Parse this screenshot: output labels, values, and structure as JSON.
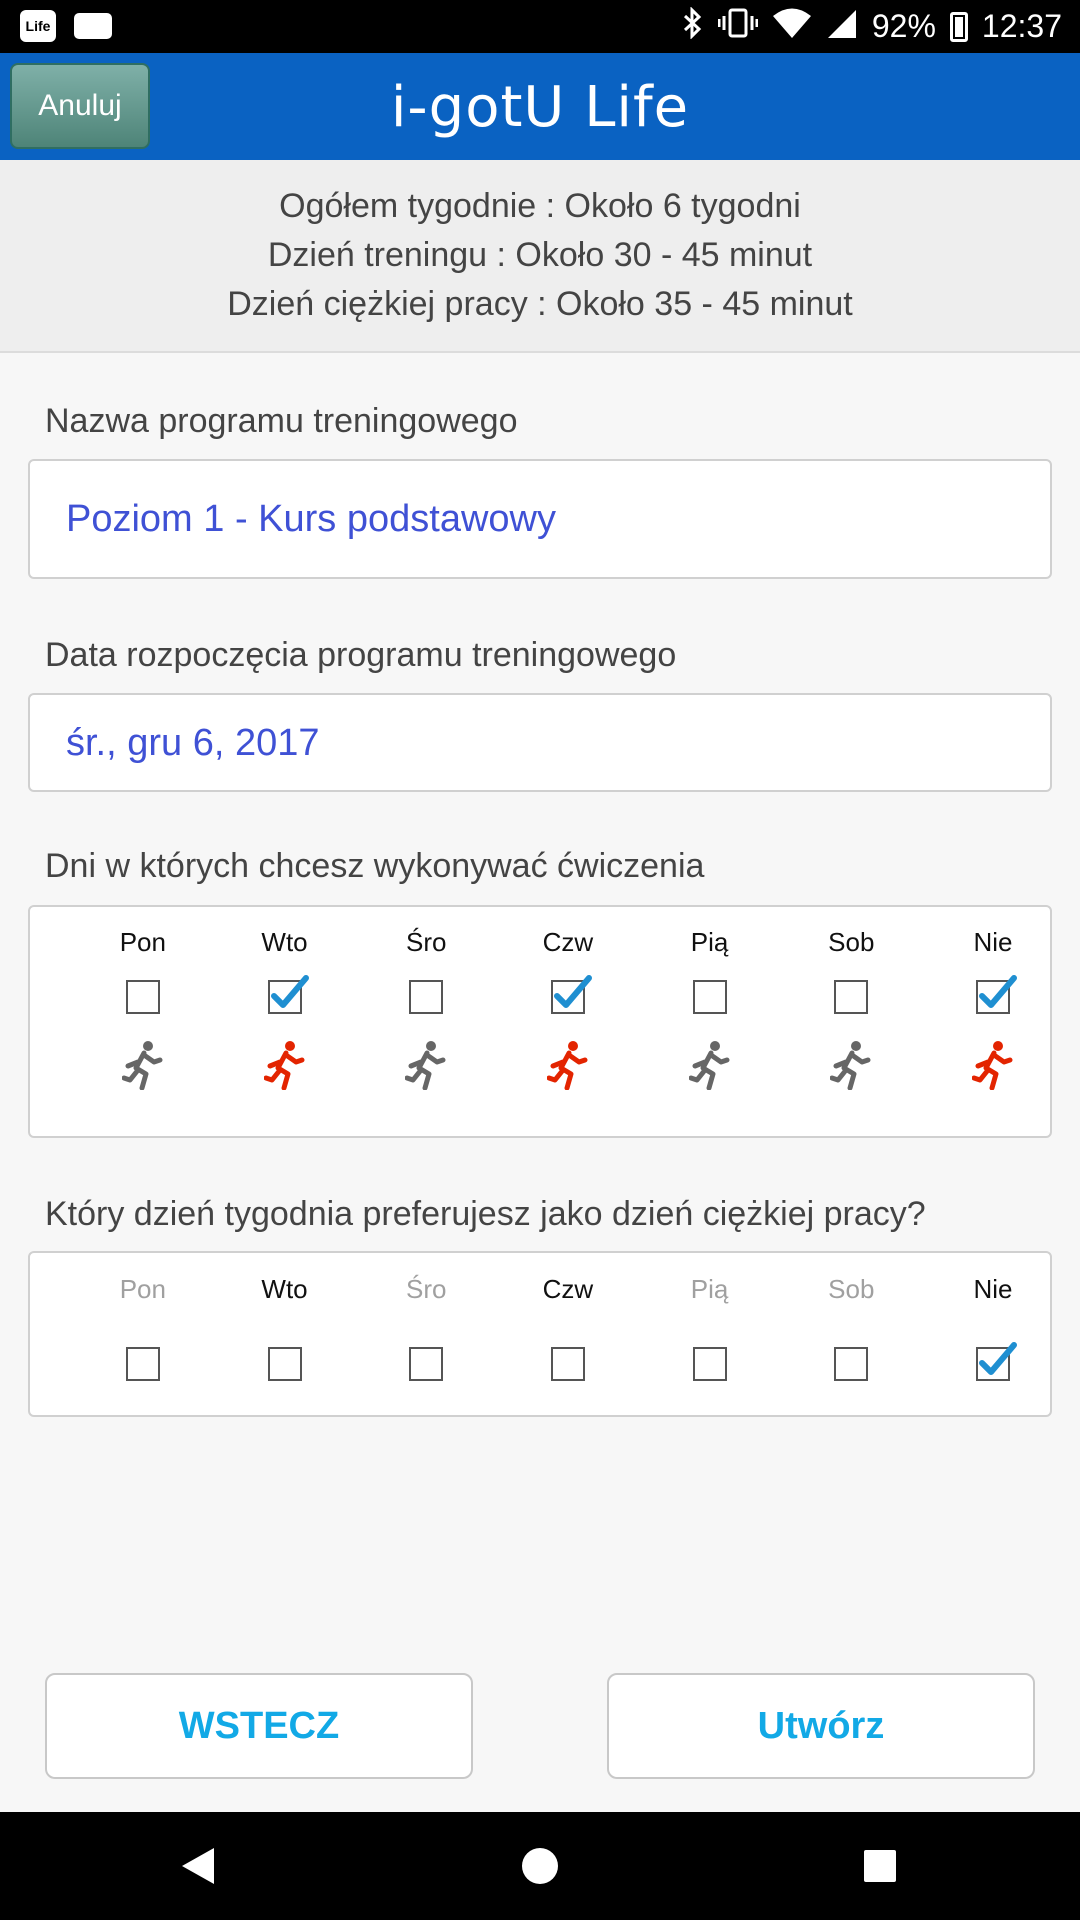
{
  "status_bar": {
    "app_icon_1": "Life",
    "battery": "92%",
    "time": "12:37",
    "icons": [
      "bluetooth-icon",
      "vibrate-icon",
      "wifi-icon",
      "signal-icon",
      "battery-icon"
    ]
  },
  "header": {
    "cancel_label": "Anuluj",
    "title": "i-gotU Life",
    "color": "#0a62c2"
  },
  "summary": {
    "line1": "Ogółem tygodnie : Około 6 tygodni",
    "line2": "Dzień treningu : Około 30 - 45 minut",
    "line3": "Dzień ciężkiej pracy : Około 35 - 45 minut"
  },
  "program_name": {
    "label": "Nazwa programu treningowego",
    "value": "Poziom 1 - Kurs podstawowy"
  },
  "start_date": {
    "label": "Data rozpoczęcia programu treningowego",
    "value": "śr., gru 6, 2017"
  },
  "exercise_days": {
    "label": "Dni w których chcesz wykonywać ćwiczenia",
    "days": [
      {
        "name": "Pon",
        "checked": false,
        "active": false
      },
      {
        "name": "Wto",
        "checked": true,
        "active": true
      },
      {
        "name": "Śro",
        "checked": false,
        "active": false
      },
      {
        "name": "Czw",
        "checked": true,
        "active": true
      },
      {
        "name": "Pią",
        "checked": false,
        "active": false
      },
      {
        "name": "Sob",
        "checked": false,
        "active": false
      },
      {
        "name": "Nie",
        "checked": true,
        "active": true
      }
    ]
  },
  "hard_day": {
    "label": "Który dzień tygodnia preferujesz jako dzień ciężkiej pracy?",
    "days": [
      {
        "name": "Pon",
        "checked": false,
        "enabled": false
      },
      {
        "name": "Wto",
        "checked": false,
        "enabled": true
      },
      {
        "name": "Śro",
        "checked": false,
        "enabled": false
      },
      {
        "name": "Czw",
        "checked": false,
        "enabled": true
      },
      {
        "name": "Pią",
        "checked": false,
        "enabled": false
      },
      {
        "name": "Sob",
        "checked": false,
        "enabled": false
      },
      {
        "name": "Nie",
        "checked": true,
        "enabled": true
      }
    ]
  },
  "buttons": {
    "back": "WSTECZ",
    "create": "Utwórz"
  },
  "colors": {
    "active_runner": "#e32400",
    "inactive_runner": "#666666",
    "check": "#1f8fd1",
    "button_text": "#12a9e6"
  }
}
